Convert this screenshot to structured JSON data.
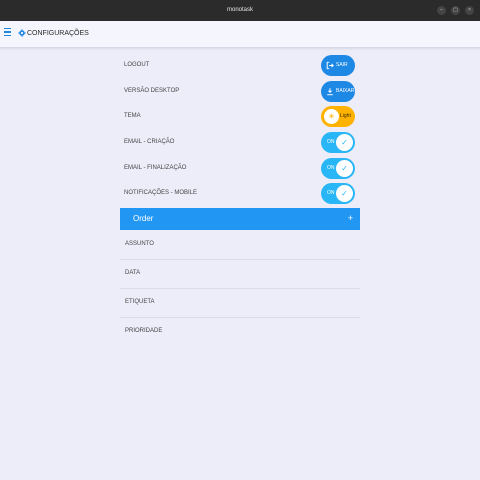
{
  "window": {
    "title": "monotask",
    "controls": [
      "–",
      "▢",
      "×"
    ]
  },
  "appbar": {
    "title": "CONFIGURAÇÕES"
  },
  "colors": {
    "primary": "#2196f3",
    "toggle_on": "#29b6f6",
    "theme_light": "#ffb300",
    "background": "#ededfa"
  },
  "settings": [
    {
      "label": "LOGOUT",
      "button": "SAIR",
      "icon": "logout-icon"
    },
    {
      "label": "VERSÃO DESKTOP",
      "button": "BAIXAR",
      "icon": "download-icon"
    },
    {
      "label": "TEMA",
      "button": "Light",
      "icon": "sun-icon"
    },
    {
      "label": "EMAIL - CRIAÇÃO",
      "toggle": "ON",
      "checked": true
    },
    {
      "label": "EMAIL - FINALIZAÇÃO",
      "toggle": "ON",
      "checked": true
    },
    {
      "label": "NOTIFICAÇÕES - MOBILE",
      "toggle": "ON",
      "checked": true
    }
  ],
  "order": {
    "title": "Order",
    "expand_icon": "+",
    "items": [
      "ASSUNTO",
      "DATA",
      "ETIQUETA",
      "PRIORIDADE"
    ]
  }
}
